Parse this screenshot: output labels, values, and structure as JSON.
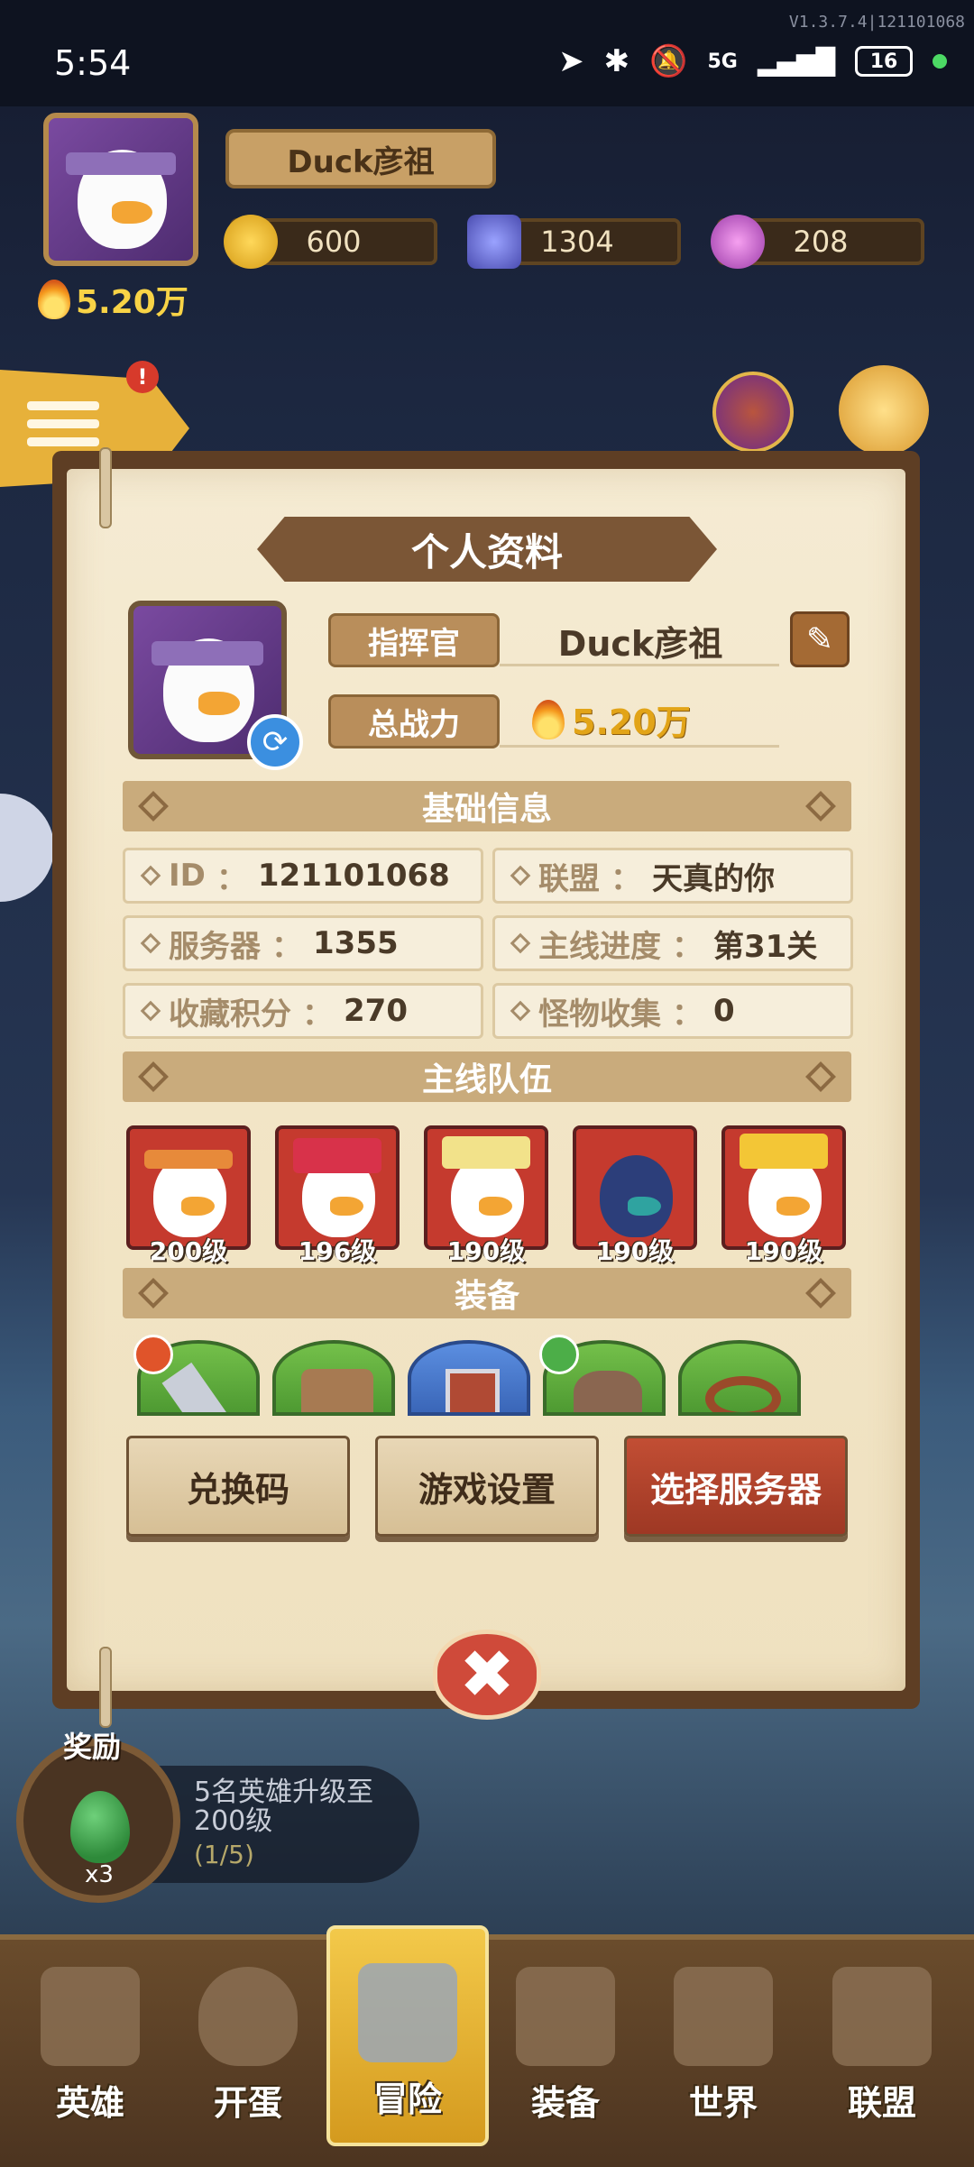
{
  "status_bar": {
    "time": "5:54",
    "battery": "16",
    "network": "5G",
    "version": "V1.3.7.4|121101068"
  },
  "hud": {
    "player_name": "Duck彦祖",
    "gold": "600",
    "gem": "1304",
    "crystal": "208",
    "power": "5.20万",
    "badge": "!"
  },
  "dialog": {
    "title": "个人资料",
    "commander_label": "指挥官",
    "commander_name": "Duck彦祖",
    "power_label": "总战力",
    "power_value": "5.20万",
    "basic_info_title": "基础信息",
    "info": [
      {
        "key": "ID",
        "value": "121101068"
      },
      {
        "key": "联盟",
        "value": "天真的你"
      },
      {
        "key": "服务器",
        "value": "1355"
      },
      {
        "key": "主线进度",
        "value": "第31关"
      },
      {
        "key": "收藏积分",
        "value": "270"
      },
      {
        "key": "怪物收集",
        "value": "0"
      }
    ],
    "team_title": "主线队伍",
    "heroes": [
      {
        "level": "200级",
        "color": "#c53a2e"
      },
      {
        "level": "196级",
        "color": "#c53a2e"
      },
      {
        "level": "190级",
        "color": "#c53a2e"
      },
      {
        "level": "190级",
        "color": "#c53a2e"
      },
      {
        "level": "190级",
        "color": "#c53a2e"
      }
    ],
    "equipment_title": "装备",
    "buttons": {
      "redeem": "兑换码",
      "settings": "游戏设置",
      "server": "选择服务器"
    },
    "close_glyph": "✖"
  },
  "reward": {
    "label": "奖励",
    "count": "x3",
    "text": "5名英雄升级至200级",
    "progress": "(1/5)"
  },
  "nav": [
    {
      "label": "英雄",
      "icon": "hero-icon"
    },
    {
      "label": "开蛋",
      "icon": "egg-icon"
    },
    {
      "label": "冒险",
      "icon": "crossed-swords-icon"
    },
    {
      "label": "装备",
      "icon": "anvil-icon"
    },
    {
      "label": "世界",
      "icon": "map-icon"
    },
    {
      "label": "联盟",
      "icon": "shield-icon"
    }
  ],
  "colors": {
    "accent": "#e2a418",
    "paper": "#f2e5c6",
    "frame": "#5e3e24",
    "server_button": "#b0442c"
  }
}
